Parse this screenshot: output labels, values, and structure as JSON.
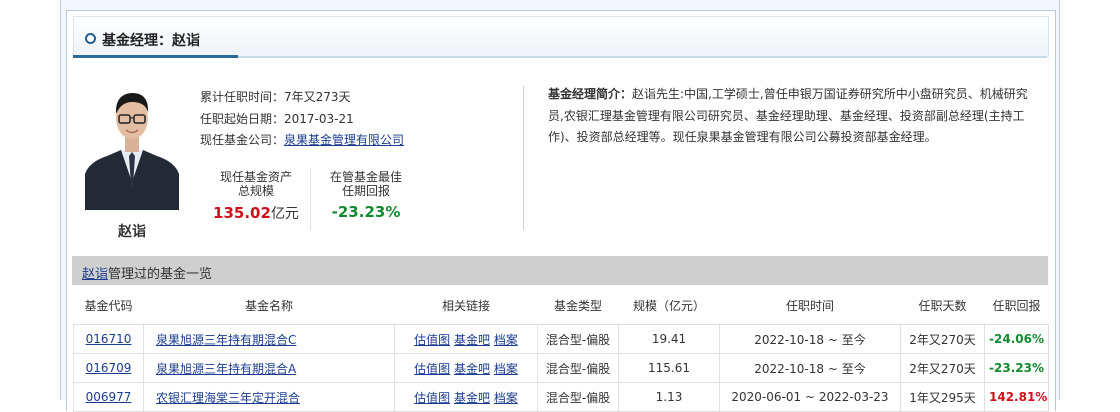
{
  "header": {
    "title": "基金经理：赵诣"
  },
  "manager": {
    "name": "赵诣",
    "tenure_label": "累计任职时间：",
    "tenure_value": "7年又273天",
    "start_label": "任职起始日期：",
    "start_value": "2017-03-21",
    "company_label": "现任基金公司：",
    "company_value": "泉果基金管理有限公司"
  },
  "stats": {
    "aum_label_1": "现任基金资产",
    "aum_label_2": "总规模",
    "aum_value": "135.02",
    "aum_unit": "亿元",
    "best_label_1": "在管基金最佳",
    "best_label_2": "任期回报",
    "best_value": "-23.23%"
  },
  "bio": {
    "label": "基金经理简介：",
    "text": "赵诣先生:中国,工学硕士,曾任申银万国证券研究所中小盘研究员、机械研究员,农银汇理基金管理有限公司研究员、基金经理助理、基金经理、投资部副总经理(主持工作)、投资部总经理等。现任泉果基金管理有限公司公募投资部基金经理。"
  },
  "fund_list": {
    "name_link": "赵诣",
    "title_suffix": "管理过的基金一览",
    "columns": [
      "基金代码",
      "基金名称",
      "相关链接",
      "基金类型",
      "规模（亿元）",
      "任职时间",
      "任职天数",
      "任职回报"
    ],
    "links": [
      "估值图",
      "基金吧",
      "档案"
    ],
    "rows": [
      {
        "code": "016710",
        "name": "泉果旭源三年持有期混合C",
        "type": "混合型-偏股",
        "scale": "19.41",
        "period": "2022-10-18 ~ 至今",
        "days": "2年又270天",
        "return": "-24.06%",
        "sign": "neg"
      },
      {
        "code": "016709",
        "name": "泉果旭源三年持有期混合A",
        "type": "混合型-偏股",
        "scale": "115.61",
        "period": "2022-10-18 ~ 至今",
        "days": "2年又270天",
        "return": "-23.23%",
        "sign": "neg"
      },
      {
        "code": "006977",
        "name": "农银汇理海棠三年定开混合",
        "type": "混合型-偏股",
        "scale": "1.13",
        "period": "2020-06-01 ~ 2022-03-23",
        "days": "1年又295天",
        "return": "142.81%",
        "sign": "pos"
      }
    ]
  },
  "colors": {
    "accent": "#2c6a96",
    "link": "#1a3d8f",
    "negative": "#128a2f",
    "positive": "#d0101b"
  }
}
